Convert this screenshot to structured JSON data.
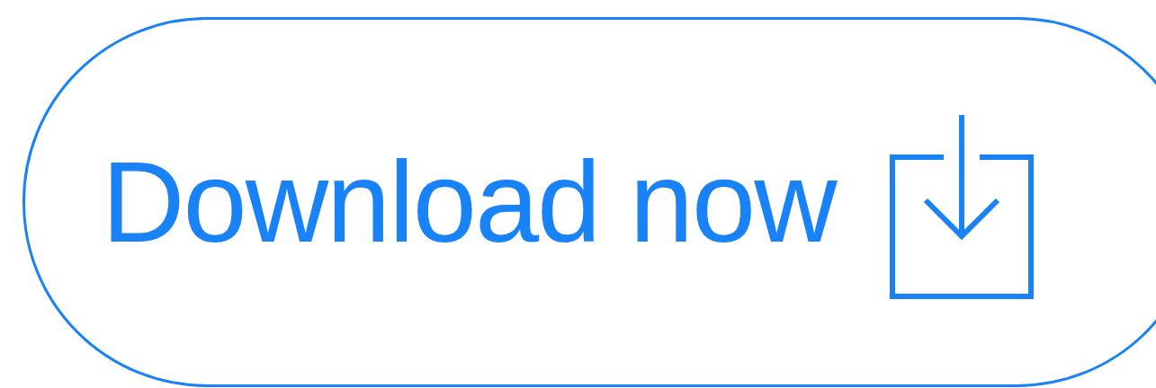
{
  "button": {
    "label": "Download now"
  }
}
